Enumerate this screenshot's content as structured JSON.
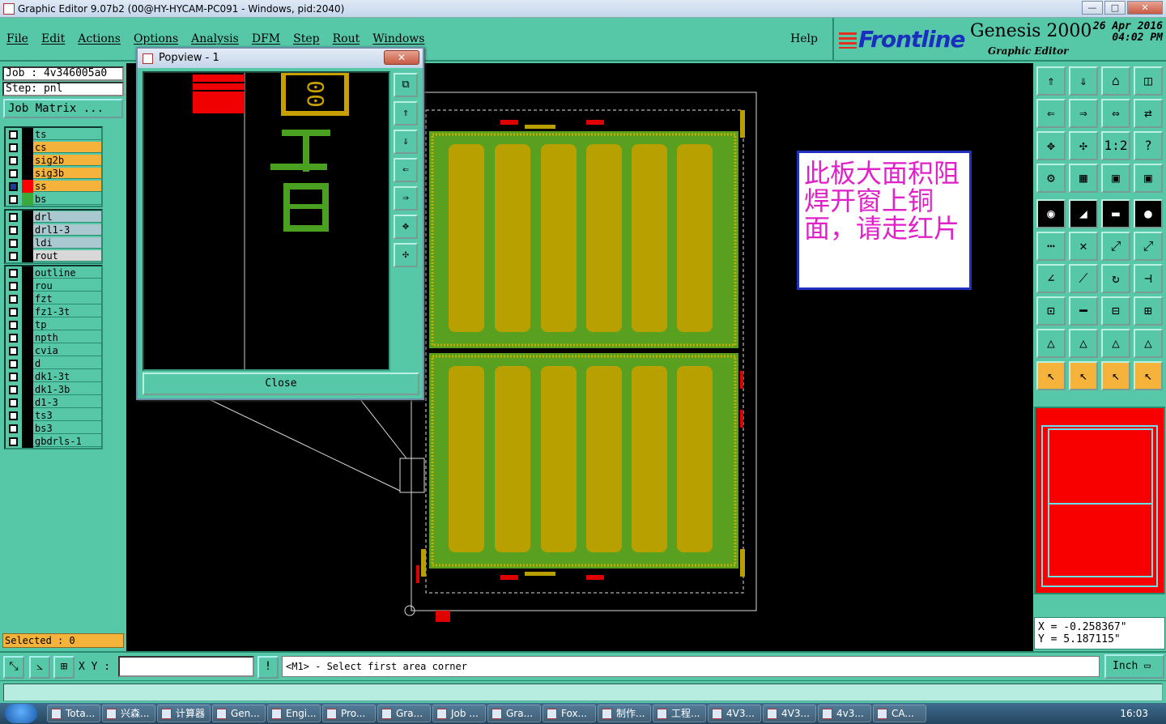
{
  "window": {
    "title": "Graphic Editor 9.07b2 (00@HY-HYCAM-PC091 - Windows, pid:2040)",
    "minimize": "—",
    "maximize": "□",
    "close": "✕"
  },
  "menu": {
    "items": [
      "File",
      "Edit",
      "Actions",
      "Options",
      "Analysis",
      "DFM",
      "Step",
      "Rout",
      "Windows"
    ],
    "help": "Help"
  },
  "brand": {
    "logo": "Frontline",
    "product": "Genesis 2000",
    "subtitle": "Graphic Editor",
    "date_line1": "26 Apr 2016",
    "date_line2": "04:02 PM"
  },
  "job": {
    "job_line": "Job : 4v346005a0",
    "step_line": "Step: pnl",
    "matrix_button": "Job Matrix ..."
  },
  "layers": {
    "group1": [
      {
        "name": "ts",
        "color": "#56c8a8",
        "on": false
      },
      {
        "name": "cs",
        "color": "#f6b33b",
        "on": false
      },
      {
        "name": "sig2b",
        "color": "#f6b33b",
        "on": false
      },
      {
        "name": "sig3b",
        "color": "#f6b33b",
        "on": false
      },
      {
        "name": "ss",
        "color": "#f6b33b",
        "on": true,
        "swatch": "#ff0000"
      },
      {
        "name": "bs",
        "color": "#56c8a8",
        "on": false,
        "swatch": "#3aa83a"
      }
    ],
    "group2": [
      {
        "name": "drl",
        "color": "#a9c8cf"
      },
      {
        "name": "drl1-3",
        "color": "#a9c8cf"
      },
      {
        "name": "ldi",
        "color": "#a9c8cf"
      },
      {
        "name": "rout",
        "color": "#d8d8d8"
      }
    ],
    "group3": [
      {
        "name": "outline"
      },
      {
        "name": "rou"
      },
      {
        "name": "fzt"
      },
      {
        "name": "fz1-3t"
      },
      {
        "name": "tp"
      },
      {
        "name": "npth"
      },
      {
        "name": "cvia"
      },
      {
        "name": "d"
      },
      {
        "name": "dk1-3t"
      },
      {
        "name": "dk1-3b"
      },
      {
        "name": "d1-3"
      },
      {
        "name": "ts3"
      },
      {
        "name": "bs3"
      },
      {
        "name": "gbdrls-1"
      }
    ]
  },
  "selected": "Selected : 0",
  "note_text": "此板大面积阻焊开窗上铜面，请走红片",
  "popview": {
    "title": "Popview - 1",
    "close_label": "Close"
  },
  "coords": {
    "x": "X = -0.258367\"",
    "y": "Y = 5.187115\""
  },
  "status": {
    "xy_label": "X Y :",
    "xy_value": "",
    "prompt": "<M1> - Select first area corner",
    "unit": "Inch"
  },
  "taskbar": {
    "tasks": [
      "Tota...",
      "兴森...",
      "计算器",
      "Gen...",
      "Engi...",
      "Pro...",
      "Gra...",
      "Job ...",
      "Gra...",
      "Fox...",
      "制作...",
      "工程...",
      "4V3...",
      "4V3...",
      "4v3...",
      "CA..."
    ],
    "clock": "16:03"
  },
  "colors": {
    "panel": "#56c8a8",
    "canvas": "#000000",
    "copper": "#b8a000",
    "mask": "#5aa020",
    "layer_red": "#ff0000"
  }
}
